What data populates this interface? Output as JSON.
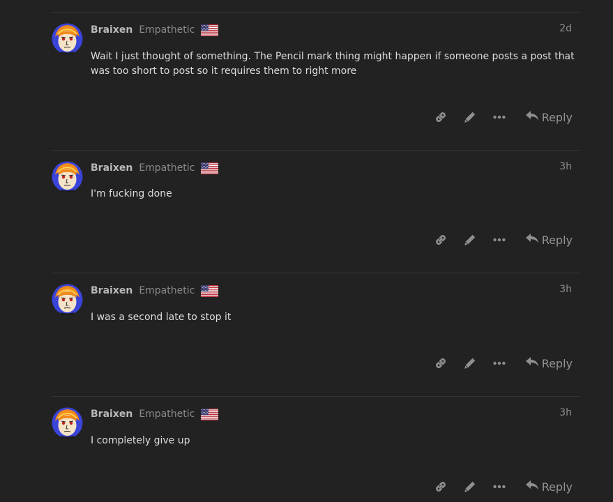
{
  "colors": {
    "background": "#222222",
    "username": "#b9b9b9",
    "user_title": "#8a8a8a",
    "body_text": "#dddddd",
    "icon": "#8f8f8f"
  },
  "icons": {
    "link": "link-icon",
    "edit": "pencil-icon",
    "more": "ellipsis-icon",
    "reply": "reply-arrow-icon",
    "flag": "us-flag-icon"
  },
  "posts": [
    {
      "username": "Braixen",
      "user_title": "Empathetic",
      "date": "2d",
      "text": "Wait I just thought of something. The Pencil mark thing might happen if someone posts a post that was too short to post so it requires them to right more",
      "reply_label": "Reply"
    },
    {
      "username": "Braixen",
      "user_title": "Empathetic",
      "date": "3h",
      "text": "I'm fucking done",
      "reply_label": "Reply"
    },
    {
      "username": "Braixen",
      "user_title": "Empathetic",
      "date": "3h",
      "text": "I was a second late to stop it",
      "reply_label": "Reply"
    },
    {
      "username": "Braixen",
      "user_title": "Empathetic",
      "date": "3h",
      "text": "I completely give up",
      "reply_label": "Reply"
    }
  ]
}
